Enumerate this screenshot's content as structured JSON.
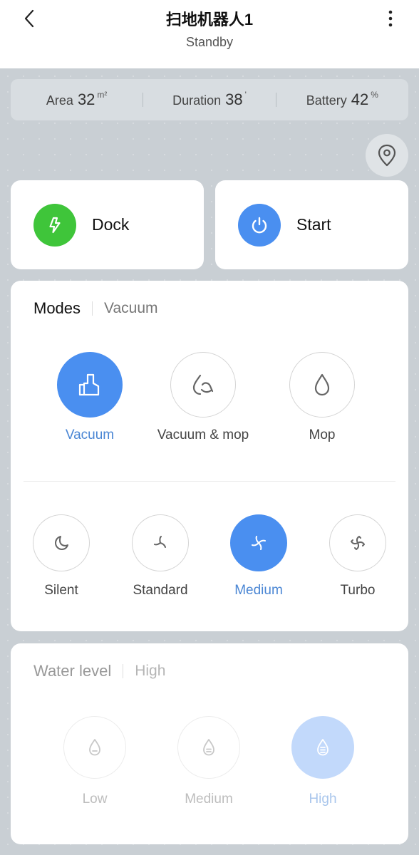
{
  "header": {
    "title": "扫地机器人1",
    "status": "Standby",
    "icons": {
      "back": "back-chevron-icon",
      "menu": "more-vertical-icon"
    }
  },
  "stats": [
    {
      "label": "Area",
      "value": "32",
      "unit": "m²"
    },
    {
      "label": "Duration",
      "value": "38",
      "unit": "'"
    },
    {
      "label": "Battery",
      "value": "42",
      "unit": "%"
    }
  ],
  "locate": {
    "icon": "location-pin-icon"
  },
  "actions": {
    "dock": {
      "label": "Dock",
      "icon": "lightning-icon",
      "color": "#3fc53a"
    },
    "start": {
      "label": "Start",
      "icon": "power-icon",
      "color": "#4a8ff0"
    }
  },
  "modes": {
    "title": "Modes",
    "current": "Vacuum",
    "options": [
      {
        "label": "Vacuum",
        "icon": "vacuum-icon",
        "selected": true
      },
      {
        "label": "Vacuum & mop",
        "icon": "vacuum-mop-icon",
        "selected": false
      },
      {
        "label": "Mop",
        "icon": "water-drop-icon",
        "selected": false
      }
    ],
    "suction": [
      {
        "label": "Silent",
        "icon": "moon-icon",
        "selected": false
      },
      {
        "label": "Standard",
        "icon": "fan-icon",
        "selected": false
      },
      {
        "label": "Medium",
        "icon": "fan-icon",
        "selected": true
      },
      {
        "label": "Turbo",
        "icon": "fan-icon",
        "selected": false
      }
    ]
  },
  "water": {
    "title": "Water level",
    "current": "High",
    "options": [
      {
        "label": "Low",
        "icon": "drop-low-icon",
        "selected": false
      },
      {
        "label": "Medium",
        "icon": "drop-medium-icon",
        "selected": false
      },
      {
        "label": "High",
        "icon": "drop-high-icon",
        "selected": true
      }
    ]
  },
  "colors": {
    "accent": "#4a8ff0",
    "dock_green": "#3fc53a",
    "background": "#c6ccd1"
  }
}
